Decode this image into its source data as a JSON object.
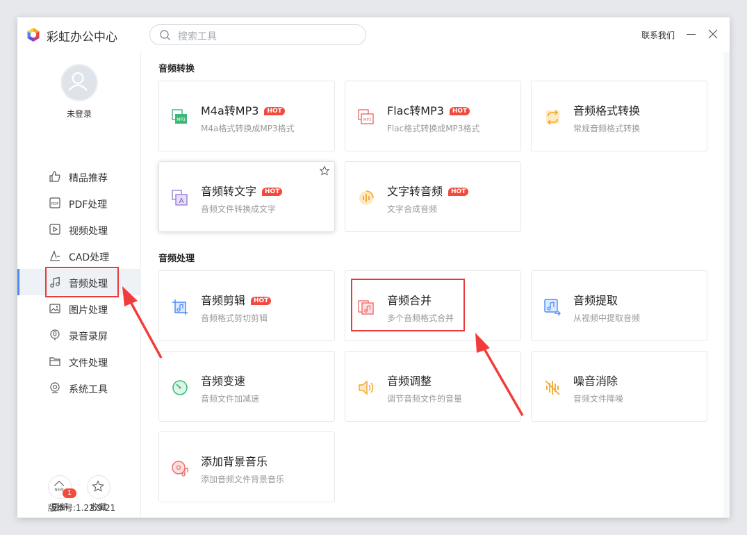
{
  "app": {
    "title": "彩虹办公中心",
    "contact": "联系我们"
  },
  "search": {
    "placeholder": "搜索工具"
  },
  "user": {
    "login_status": "未登录"
  },
  "sidebar": {
    "items": [
      {
        "label": "精品推荐",
        "icon": "thumbs-up-icon"
      },
      {
        "label": "PDF处理",
        "icon": "pdf-icon"
      },
      {
        "label": "视频处理",
        "icon": "video-play-icon"
      },
      {
        "label": "CAD处理",
        "icon": "cad-icon"
      },
      {
        "label": "音频处理",
        "icon": "music-note-icon",
        "active": true
      },
      {
        "label": "图片处理",
        "icon": "image-icon"
      },
      {
        "label": "录音录屏",
        "icon": "record-icon"
      },
      {
        "label": "文件处理",
        "icon": "folder-icon"
      },
      {
        "label": "系统工具",
        "icon": "system-tool-icon"
      }
    ],
    "update_label": "更新",
    "update_badge": "1",
    "update_icon_text": "NEW",
    "favorites_label": "收藏",
    "version": "版本号:1.22.9.21"
  },
  "sections": [
    {
      "title": "音频转换",
      "cards": [
        {
          "title": "M4a转MP3",
          "desc": "M4a格式转换成MP3格式",
          "hot": true,
          "icon": "m4a-to-mp3-icon"
        },
        {
          "title": "Flac转MP3",
          "desc": "Flac格式转换成MP3格式",
          "hot": true,
          "icon": "flac-to-mp3-icon"
        },
        {
          "title": "音频格式转换",
          "desc": "常规音频格式转换",
          "hot": false,
          "icon": "audio-format-convert-icon"
        },
        {
          "title": "音频转文字",
          "desc": "音频文件转换成文字",
          "hot": true,
          "icon": "audio-to-text-icon"
        },
        {
          "title": "文字转音频",
          "desc": "文字合成音频",
          "hot": true,
          "icon": "text-to-audio-icon"
        }
      ]
    },
    {
      "title": "音频处理",
      "cards": [
        {
          "title": "音频剪辑",
          "desc": "音频格式剪切剪辑",
          "hot": true,
          "icon": "audio-crop-icon"
        },
        {
          "title": "音频合并",
          "desc": "多个音频格式合并",
          "hot": false,
          "icon": "audio-merge-icon"
        },
        {
          "title": "音频提取",
          "desc": "从视频中提取音频",
          "hot": false,
          "icon": "audio-extract-icon"
        },
        {
          "title": "音频变速",
          "desc": "音频文件加减速",
          "hot": false,
          "icon": "audio-speed-icon"
        },
        {
          "title": "音频调整",
          "desc": "调节音频文件的音量",
          "hot": false,
          "icon": "volume-icon"
        },
        {
          "title": "噪音消除",
          "desc": "音频文件降噪",
          "hot": false,
          "icon": "noise-reduction-icon"
        },
        {
          "title": "添加背景音乐",
          "desc": "添加音频文件背景音乐",
          "hot": false,
          "icon": "background-music-icon"
        }
      ]
    }
  ],
  "hot_label": "HOT",
  "colors": {
    "accent": "#4c8bf5",
    "hot": "#f24a3d",
    "annotation": "#e83a3a"
  }
}
